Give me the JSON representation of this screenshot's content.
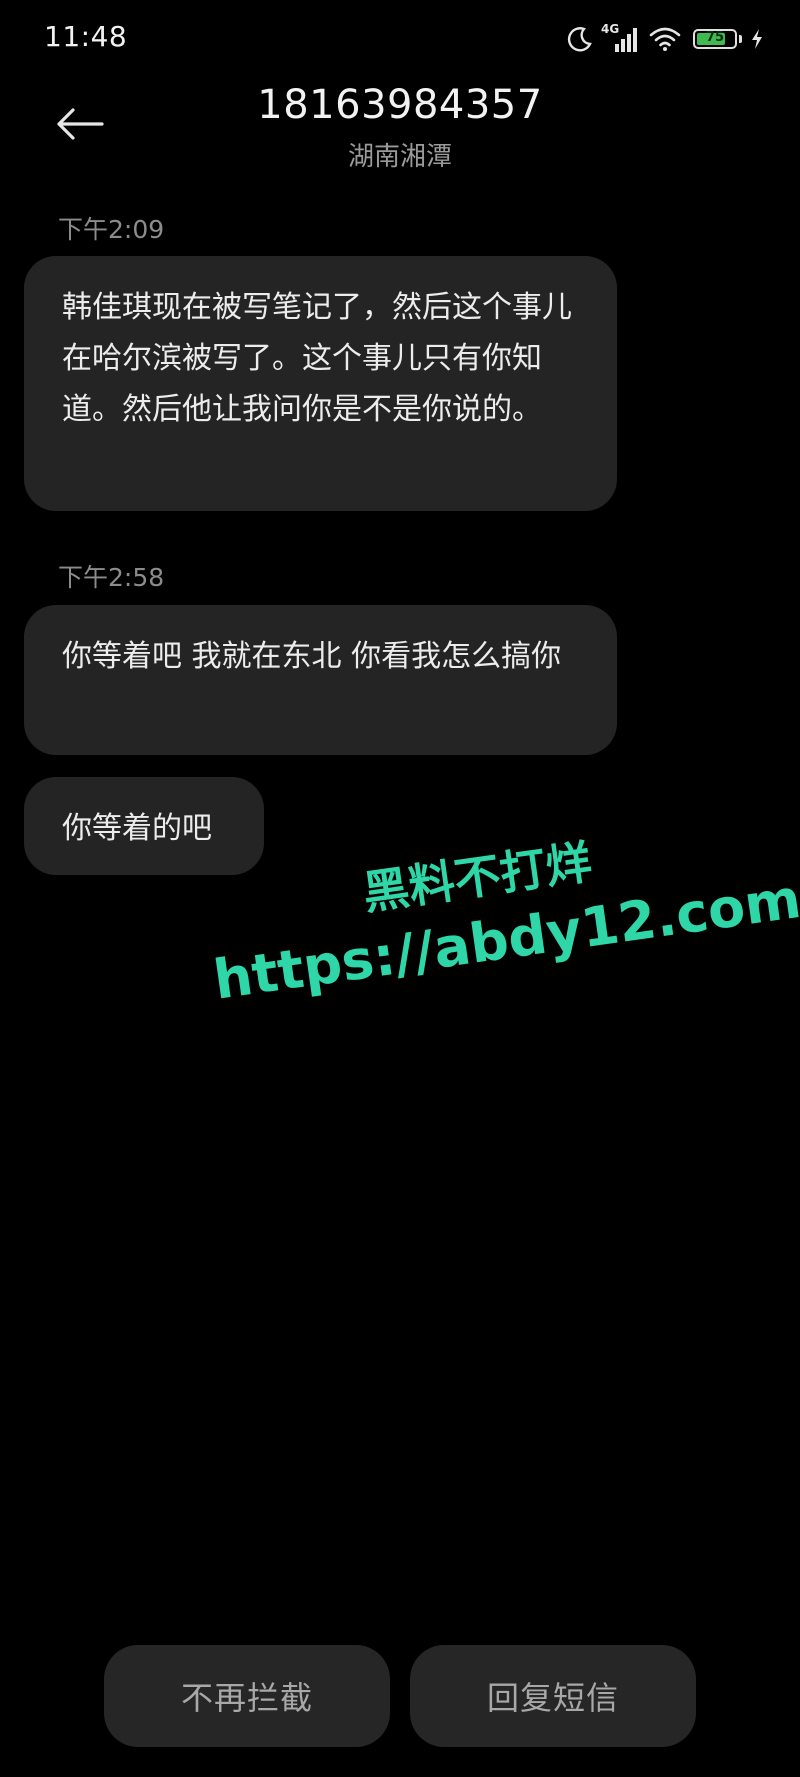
{
  "status_bar": {
    "time": "11:48",
    "network": "4G",
    "battery": "75",
    "battery_level_percent": 75,
    "icons": [
      "moon-icon",
      "signal-icon",
      "wifi-icon",
      "battery-icon",
      "charging-icon"
    ]
  },
  "header": {
    "title": "18163984357",
    "subtitle": "湖南湘潭",
    "back_icon": "back-arrow-icon"
  },
  "messages": [
    {
      "timestamp": "下午2:09",
      "text": "韩佳琪现在被写笔记了，然后这个事儿在哈尔滨被写了。这个事儿只有你知道。然后他让我问你是不是你说的。"
    },
    {
      "timestamp": "下午2:58",
      "text": "你等着吧 我就在东北 你看我怎么搞你"
    },
    {
      "text": "你等着的吧"
    }
  ],
  "watermark": {
    "line1": "黑料不打烊",
    "line2": "https://abdy12.com",
    "color": "#2fd6a8"
  },
  "actions": {
    "unblock_label": "不再拦截",
    "reply_label": "回复短信"
  },
  "colors": {
    "background": "#000000",
    "bubble": "#242424",
    "button": "#262626"
  }
}
